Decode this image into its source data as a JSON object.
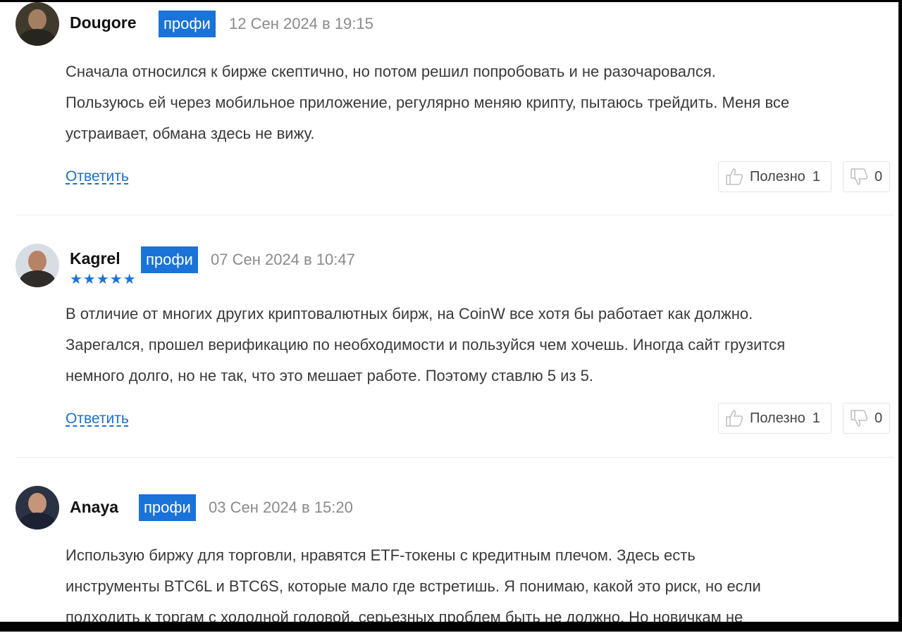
{
  "comments": [
    {
      "author": "Dougore",
      "badge": "профи",
      "date": "12 Сен 2024 в 19:15",
      "stars": "",
      "lines": [
        "Сначала относился к бирже скептично, но потом решил попробовать и не разочаровался.",
        "Пользуюсь ей через мобильное приложение, регулярно меняю крипту, пытаюсь трейдить. Меня все",
        "устраивает, обмана здесь не вижу."
      ],
      "reply_label": "Ответить",
      "useful_label": "Полезно",
      "useful_count": "1",
      "dislike_count": "0"
    },
    {
      "author": "Kagrel",
      "badge": "профи",
      "date": "07 Сен 2024 в 10:47",
      "stars": "★★★★★",
      "rating": 5,
      "lines": [
        "В отличие от многих других криптовалютных бирж, на CoinW все хотя бы работает как должно.",
        "Зарегался, прошел верификацию по необходимости и пользуйся чем хочешь. Иногда сайт грузится",
        "немного долго, но не так, что это мешает работе. Поэтому ставлю 5 из 5."
      ],
      "reply_label": "Ответить",
      "useful_label": "Полезно",
      "useful_count": "1",
      "dislike_count": "0"
    },
    {
      "author": "Anaya",
      "badge": "профи",
      "date": "03 Сен 2024 в 15:20",
      "stars": "",
      "lines": [
        "Использую биржу для торговли, нравятся ETF-токены с кредитным плечом. Здесь есть",
        "инструменты BTC6L и BTC6S, которые мало где встретишь. Я понимаю, какой это риск, но если",
        "подходить к торгам с холодной головой, серьезных проблем быть не должно. Но новичкам не"
      ]
    }
  ],
  "colors": {
    "accent": "#1a73d9",
    "link": "#1a6fcf",
    "date": "#8a8a8a"
  },
  "icons": {
    "useful": "thumbs-up-icon",
    "dislike": "thumbs-down-icon"
  }
}
